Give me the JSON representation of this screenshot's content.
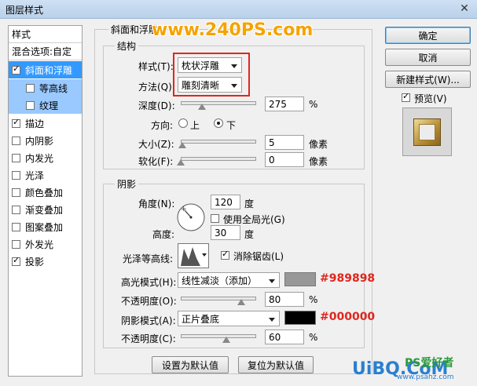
{
  "window": {
    "title": "图层样式",
    "close": "✕"
  },
  "sidebar": {
    "header1": "样式",
    "header2": "混合选项:自定",
    "items": [
      {
        "label": "斜面和浮雕",
        "checked": true,
        "state": "selected"
      },
      {
        "label": "等高线",
        "checked": false,
        "state": "sub"
      },
      {
        "label": "纹理",
        "checked": false,
        "state": "sub"
      },
      {
        "label": "描边",
        "checked": true
      },
      {
        "label": "内阴影",
        "checked": false
      },
      {
        "label": "内发光",
        "checked": false
      },
      {
        "label": "光泽",
        "checked": false
      },
      {
        "label": "颜色叠加",
        "checked": false
      },
      {
        "label": "渐变叠加",
        "checked": false
      },
      {
        "label": "图案叠加",
        "checked": false
      },
      {
        "label": "外发光",
        "checked": false
      },
      {
        "label": "投影",
        "checked": true
      }
    ]
  },
  "bevel": {
    "group_title": "斜面和浮雕",
    "structure_title": "结构",
    "style_label": "样式(T):",
    "style_value": "枕状浮雕",
    "method_label": "方法(Q):",
    "method_value": "雕刻清晰",
    "depth_label": "深度(D):",
    "depth_value": "275",
    "depth_unit": "%",
    "depth_level": 0.28,
    "direction_label": "方向:",
    "dir_up": "上",
    "dir_down": "下",
    "size_label": "大小(Z):",
    "size_value": "5",
    "size_unit": "像素",
    "size_level": 0.02,
    "soften_label": "软化(F):",
    "soften_value": "0",
    "soften_unit": "像素",
    "soften_level": 0.0
  },
  "shading": {
    "title": "阴影",
    "angle_label": "角度(N):",
    "angle_value": "120",
    "angle_unit": "度",
    "global_light": "使用全局光(G)",
    "altitude_label": "高度:",
    "altitude_value": "30",
    "altitude_unit": "度",
    "gloss_label": "光泽等高线:",
    "antialias": "消除锯齿(L)",
    "highlight_label": "高光模式(H):",
    "highlight_mode": "线性减淡（添加）",
    "highlight_color": "#989898",
    "highlight_hex": "#989898",
    "hl_opacity_label": "不透明度(O):",
    "hl_opacity_value": "80",
    "hl_opacity_unit": "%",
    "hl_opacity_level": 0.8,
    "shadow_label": "阴影模式(A):",
    "shadow_mode": "正片叠底",
    "shadow_color": "#000000",
    "shadow_hex": "#000000",
    "sh_opacity_label": "不透明度(C):",
    "sh_opacity_value": "60",
    "sh_opacity_unit": "%",
    "sh_opacity_level": 0.6
  },
  "buttons": {
    "ok": "确定",
    "cancel": "取消",
    "new_style": "新建样式(W)...",
    "preview": "预览(V)",
    "set_default": "设置为默认值",
    "reset_default": "复位为默认值"
  },
  "watermark": {
    "top": "www.240PS.com",
    "bottom_brand": "UiBQ.CoM",
    "bottom_sub": "PS爱好者",
    "bottom_small": "www.psahz.com"
  },
  "colors": {
    "accent": "#3399ff",
    "annotation": "#e0261e",
    "watermark": "#f5a300"
  }
}
